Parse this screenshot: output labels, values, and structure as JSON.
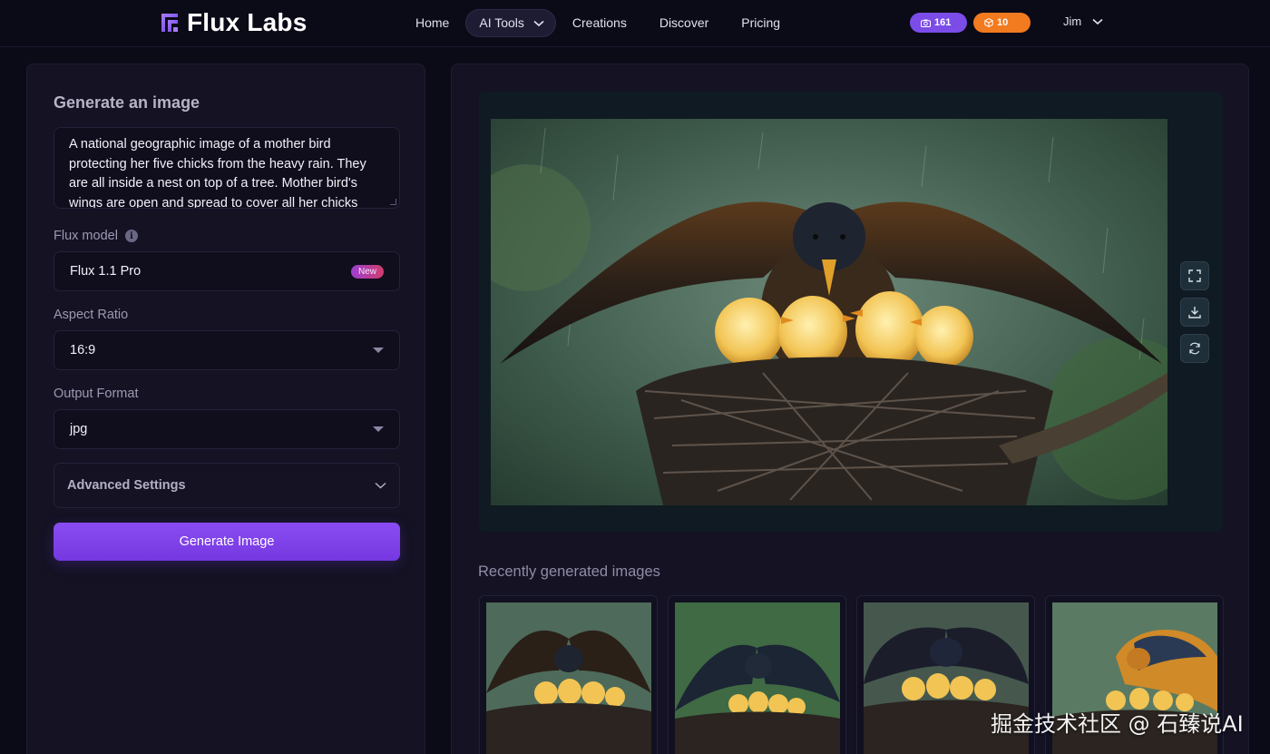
{
  "brand": {
    "name": "Flux Labs",
    "accent": "#7b4ce8"
  },
  "nav": {
    "items": [
      "Home",
      "AI Tools",
      "Creations",
      "Discover",
      "Pricing"
    ],
    "active": "AI Tools"
  },
  "badges": {
    "credits": "161",
    "tokens": "10",
    "credits_color": "#7b4ce8",
    "tokens_color": "#f27a1f"
  },
  "user": {
    "name": "Jim"
  },
  "form": {
    "title": "Generate an image",
    "prompt": "A national geographic image of a mother bird protecting her five chicks from the heavy rain. They are all inside a nest on top of a tree. Mother bird's wings are open and spread to cover all her chicks",
    "model_label": "Flux model",
    "model_value": "Flux 1.1 Pro",
    "model_tag": "New",
    "aspect_label": "Aspect Ratio",
    "aspect_value": "16:9",
    "format_label": "Output Format",
    "format_value": "jpg",
    "advanced_label": "Advanced Settings",
    "generate_label": "Generate Image"
  },
  "preview": {
    "tools": [
      "expand-icon",
      "download-icon",
      "refresh-icon"
    ]
  },
  "recent": {
    "title": "Recently generated images",
    "count": 4
  },
  "watermark": "掘金技术社区 @ 石臻说AI"
}
